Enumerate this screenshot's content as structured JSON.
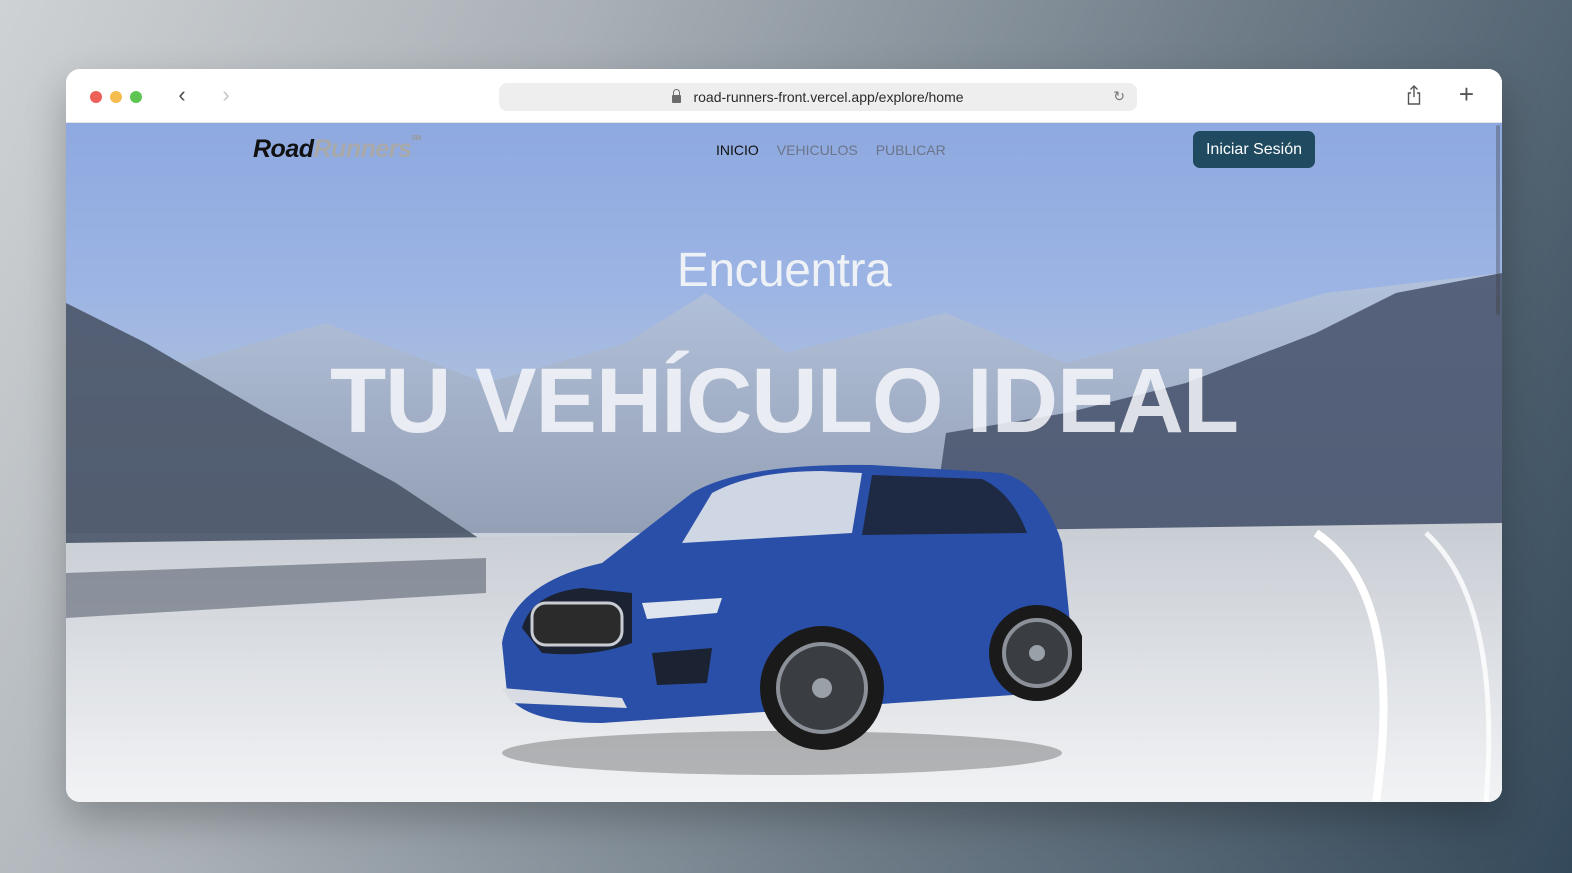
{
  "browser": {
    "url": "road-runners-front.vercel.app/explore/home"
  },
  "site": {
    "logo_part1": "Road",
    "logo_part2": "Runners",
    "logo_mark": "SM",
    "nav": [
      {
        "label": "INICIO",
        "active": true
      },
      {
        "label": "VEHICULOS",
        "active": false
      },
      {
        "label": "PUBLICAR",
        "active": false
      }
    ],
    "login_label": "Iniciar Sesión",
    "login_color": "#1f4a60"
  },
  "hero": {
    "subtitle": "Encuentra",
    "title": "TU VEHÍCULO IDEAL"
  },
  "icons": [
    "lock-icon",
    "reload-icon",
    "share-icon",
    "new-tab-plus-icon",
    "back-arrow-icon",
    "forward-arrow-icon"
  ]
}
